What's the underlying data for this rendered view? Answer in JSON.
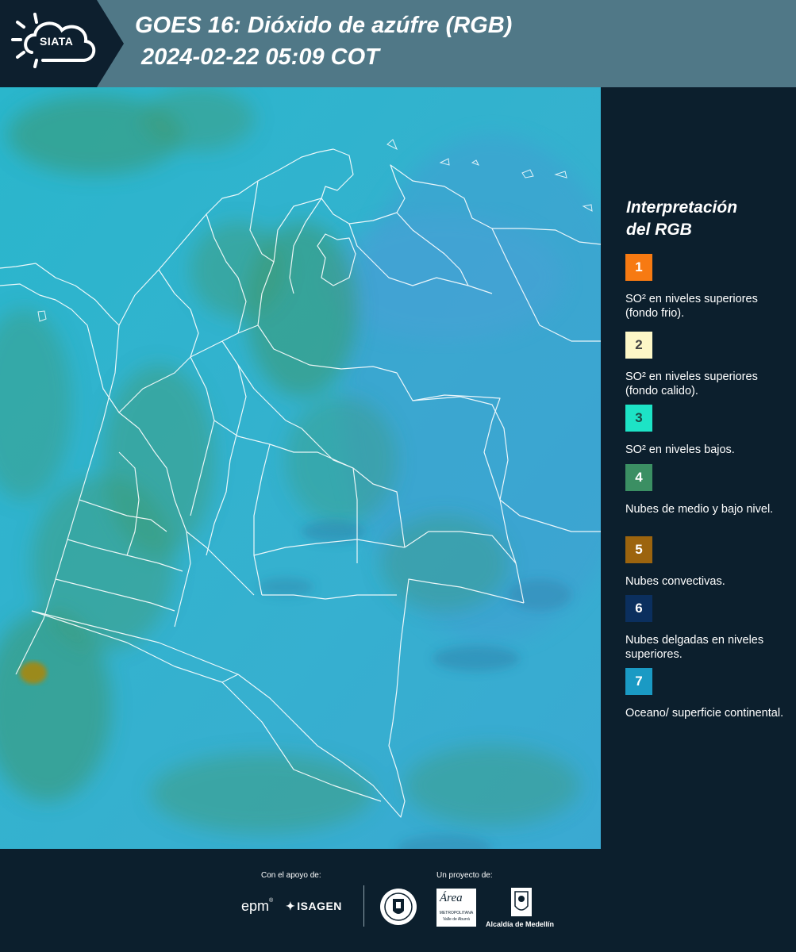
{
  "header": {
    "logo_text": "SIATA",
    "title_line1": "GOES 16: Dióxido de azúfre (RGB)",
    "title_line2": "2024-02-22 05:09 COT"
  },
  "legend": {
    "title_line1": "Interpretación",
    "title_line2": "del RGB",
    "items": [
      {
        "number": "1",
        "color": "#f77a12",
        "text_color": "#ffffff",
        "label": "SO² en niveles superiores (fondo frio)."
      },
      {
        "number": "2",
        "color": "#fdf7c7",
        "text_color": "#444444",
        "label": "SO² en niveles superiores (fondo calido)."
      },
      {
        "number": "3",
        "color": "#1de3c6",
        "text_color": "#1a4a44",
        "label": "SO² en niveles bajos."
      },
      {
        "number": "4",
        "color": "#3b8f63",
        "text_color": "#ffffff",
        "label": "Nubes de medio y bajo nivel."
      },
      {
        "number": "5",
        "color": "#9c640e",
        "text_color": "#ffffff",
        "label": "Nubes convectivas."
      },
      {
        "number": "6",
        "color": "#0b2f5e",
        "text_color": "#ffffff",
        "label": "Nubes delgadas en niveles superiores."
      },
      {
        "number": "7",
        "color": "#1a9ac4",
        "text_color": "#ffffff",
        "label": "Oceano/ superficie continental."
      }
    ]
  },
  "footer": {
    "support_caption": "Con el apoyo de:",
    "project_caption": "Un proyecto de:",
    "sponsor_epm": "epm",
    "sponsor_isagen": "ISAGEN",
    "area_logo_text": "Área",
    "area_subtitle": "METROPOLITANA",
    "area_subtitle2": "Valle de Aburrá",
    "alcaldia_label": "Alcaldía de Medellín"
  },
  "map": {
    "background_color": "#2fb3cc",
    "ocean_east_color": "#3fa6d0",
    "cloud_green_color": "#3f9a6e",
    "convective_color": "#9b8a1e",
    "border_color": "#ffffff"
  }
}
